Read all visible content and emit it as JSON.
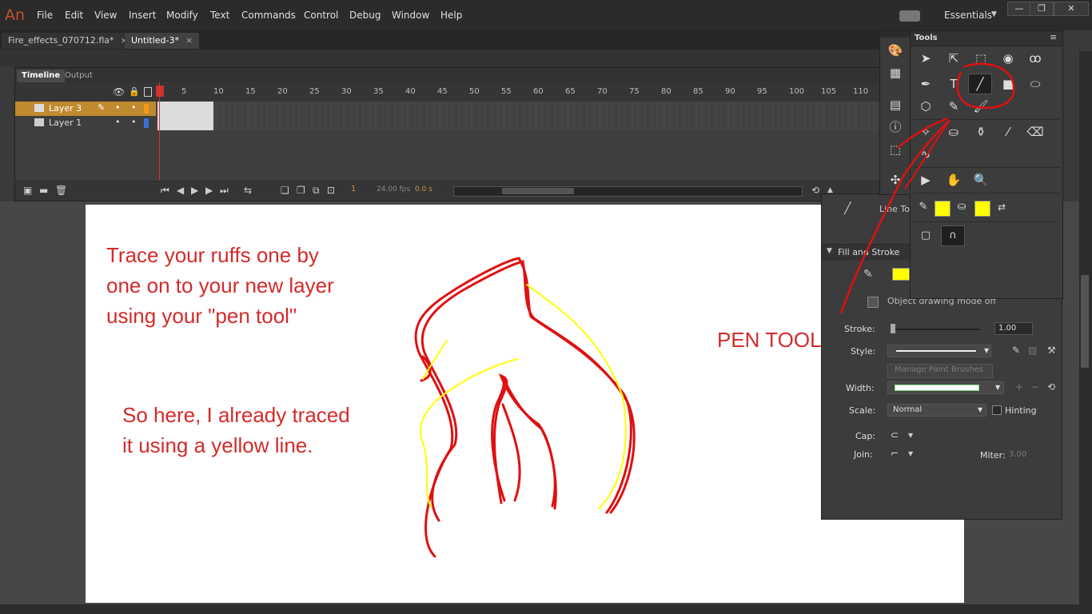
{
  "app": {
    "logo": "An"
  },
  "menu": [
    "File",
    "Edit",
    "View",
    "Insert",
    "Modify",
    "Text",
    "Commands",
    "Control",
    "Debug",
    "Window",
    "Help"
  ],
  "workspace": {
    "label": "Essentials"
  },
  "window_controls": {
    "minimize": "—",
    "restore": "❐",
    "close": "✕"
  },
  "doc_tabs": [
    {
      "label": "Fire_effects_070712.fla*",
      "close": "×"
    },
    {
      "label": "Untitled-3*",
      "close": "×"
    }
  ],
  "timeline": {
    "tabs": [
      "Timeline",
      "Output"
    ],
    "frame_numbers": [
      "1",
      "5",
      "10",
      "15",
      "20",
      "25",
      "30",
      "35",
      "40",
      "45",
      "50",
      "55",
      "60",
      "65",
      "70",
      "75",
      "80",
      "85",
      "90",
      "95",
      "100",
      "105",
      "110"
    ],
    "layers": [
      {
        "name": "Layer 3",
        "color": "#f39a17",
        "selected": true
      },
      {
        "name": "Layer 1",
        "color": "#3d6fd8",
        "selected": false
      }
    ],
    "current_frame": "1",
    "fps": "24.00 fps",
    "time": "0.0 s"
  },
  "tools": {
    "title": "Tools",
    "selected_tool": "line-tool",
    "stroke_color": "#ffff00",
    "fill_color": "#ffff00"
  },
  "properties": {
    "tool_name": "Line Tool",
    "fill_and_stroke": "Fill and Stroke",
    "object_drawing_mode": "Object drawing mode off",
    "stroke_label": "Stroke:",
    "stroke_value": "1.00",
    "style_label": "Style:",
    "manage_brushes": "Manage Paint Brushes",
    "width_label": "Width:",
    "scale_label": "Scale:",
    "scale_value": "Normal",
    "hinting_label": "Hinting",
    "cap_label": "Cap:",
    "join_label": "Join:",
    "miter_label": "Miter:",
    "miter_value": "3.00"
  },
  "annotations": {
    "note1": "Trace your ruffs one by\none on to your new layer\nusing your \"pen tool\"",
    "note2": "So here, I already traced\nit using a yellow line.",
    "pen_tool_label": "PEN TOOL"
  },
  "colors": {
    "annotation_red": "#d32b2b",
    "trace_yellow": "#ffff00"
  }
}
